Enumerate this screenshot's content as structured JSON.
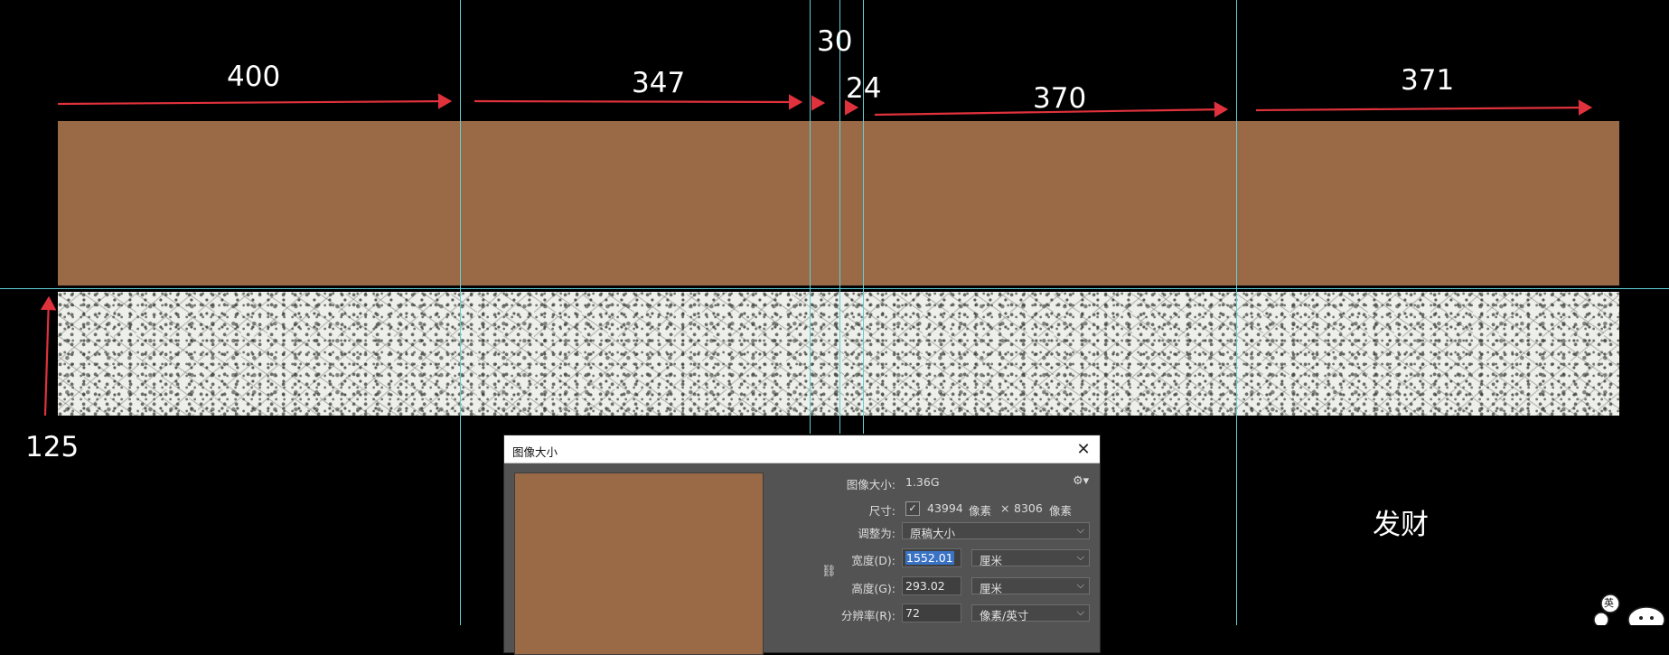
{
  "annotations": {
    "seg1": "400",
    "seg2": "347",
    "seg3": "30",
    "seg4": "24",
    "seg5": "370",
    "seg6": "371",
    "height": "125",
    "note": "发财"
  },
  "colors": {
    "brown": "#9a6a47",
    "guide": "#5fcfd6",
    "arrow": "#e0323c",
    "dialog_bg": "#535353"
  },
  "dialog": {
    "title": "图像大小",
    "close_icon": "close-icon",
    "image_size_label": "图像大小:",
    "image_size_value": "1.36G",
    "dimensions_label": "尺寸:",
    "dim_width": "43994",
    "dim_unit1": "像素",
    "dim_times": "×",
    "dim_height": "8306",
    "dim_unit2": "像素",
    "fit_label": "调整为:",
    "fit_value": "原稿大小",
    "width_label": "宽度(D):",
    "width_value": "1552.01",
    "width_unit": "厘米",
    "height_label": "高度(G):",
    "height_value": "293.02",
    "height_unit": "厘米",
    "resolution_label": "分辨率(R):",
    "resolution_value": "72",
    "resolution_unit": "像素/英寸"
  },
  "watermark": {
    "badge": "英"
  }
}
